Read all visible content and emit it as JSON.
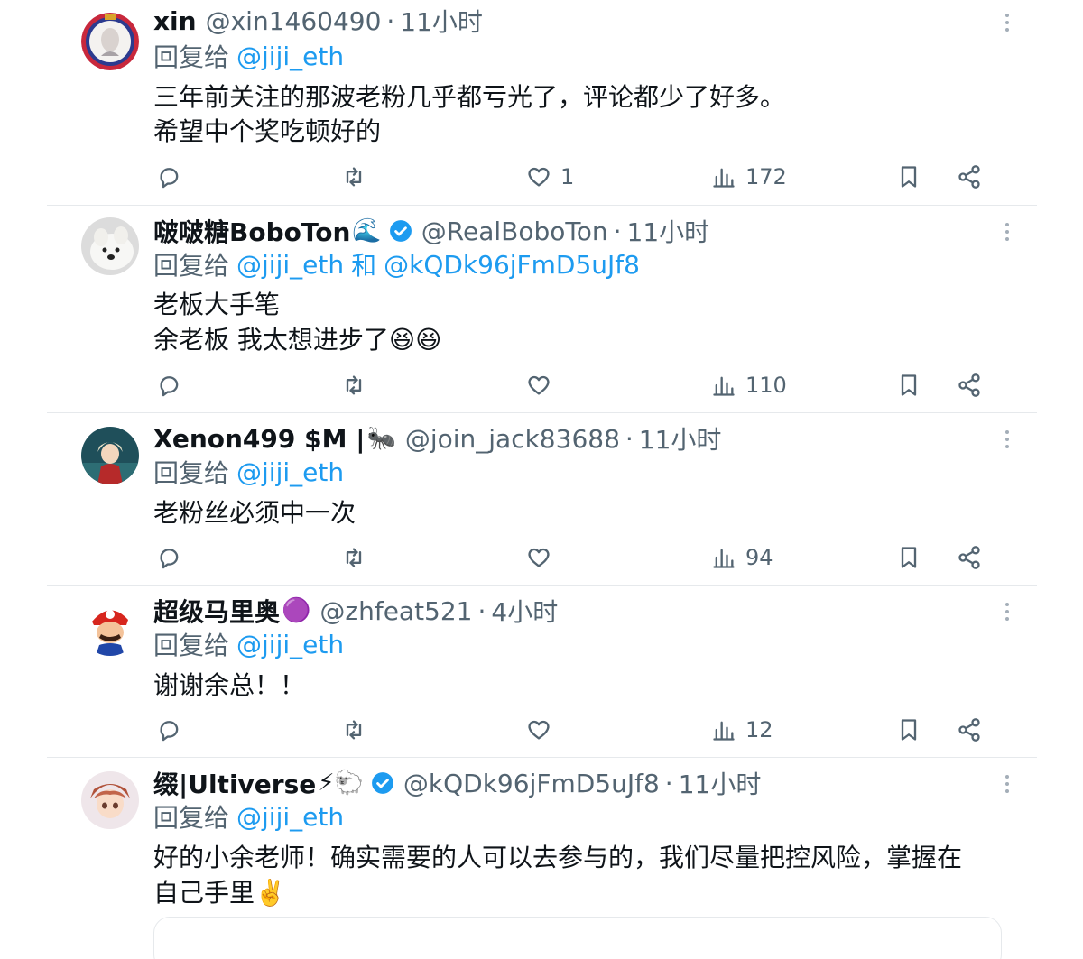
{
  "tweets": [
    {
      "display_name": "xin",
      "name_emoji": "",
      "verified": false,
      "handle": "@xin1460490",
      "time": "11小时",
      "reply_prefix": "回复给",
      "reply_to": "@jiji_eth",
      "reply_and": "",
      "reply_to_2": "",
      "body": [
        "三年前关注的那波老粉几乎都亏光了，评论都少了好多。",
        "希望中个奖吃顿好的"
      ],
      "likes": "1",
      "views": "172"
    },
    {
      "display_name": "啵啵糖BoboTon",
      "name_emoji": "🌊",
      "verified": true,
      "handle": "@RealBoboTon",
      "time": "11小时",
      "reply_prefix": "回复给",
      "reply_to": "@jiji_eth",
      "reply_and": "和",
      "reply_to_2": "@kQDk96jFmD5uJf8",
      "body": [
        "老板大手笔",
        "余老板 我太想进步了😆😆"
      ],
      "likes": "",
      "views": "110"
    },
    {
      "display_name": "Xenon499 $M |",
      "name_emoji": "🐜",
      "verified": false,
      "handle": "@join_jack83688",
      "time": "11小时",
      "reply_prefix": "回复给",
      "reply_to": "@jiji_eth",
      "reply_and": "",
      "reply_to_2": "",
      "body": [
        "老粉丝必须中一次"
      ],
      "likes": "",
      "views": "94"
    },
    {
      "display_name": "超级马里奥",
      "name_emoji": "🟣",
      "verified": false,
      "handle": "@zhfeat521",
      "time": "4小时",
      "reply_prefix": "回复给",
      "reply_to": "@jiji_eth",
      "reply_and": "",
      "reply_to_2": "",
      "body": [
        "谢谢余总！！"
      ],
      "likes": "",
      "views": "12"
    },
    {
      "display_name": "缀|Ultiverse",
      "name_emoji": "⚡🐑",
      "verified": true,
      "handle": "@kQDk96jFmD5uJf8",
      "time": "11小时",
      "reply_prefix": "回复给",
      "reply_to": "@jiji_eth",
      "reply_and": "",
      "reply_to_2": "",
      "body": [
        "好的小余老师！确实需要的人可以去参与的，我们尽量把控风险，掌握在",
        "自己手里✌️"
      ],
      "likes": "",
      "views": ""
    }
  ],
  "separator_dot": "·",
  "icons": {
    "reply": "reply-icon",
    "retweet": "retweet-icon",
    "like": "heart-icon",
    "views": "views-icon",
    "bookmark": "bookmark-icon",
    "share": "share-icon",
    "more": "more-icon",
    "verified": "verified-badge-icon"
  },
  "colors": {
    "link": "#1d9bf0",
    "secondary_text": "#536471",
    "verified": "#1d9bf0",
    "divider": "#e6e9ec"
  }
}
